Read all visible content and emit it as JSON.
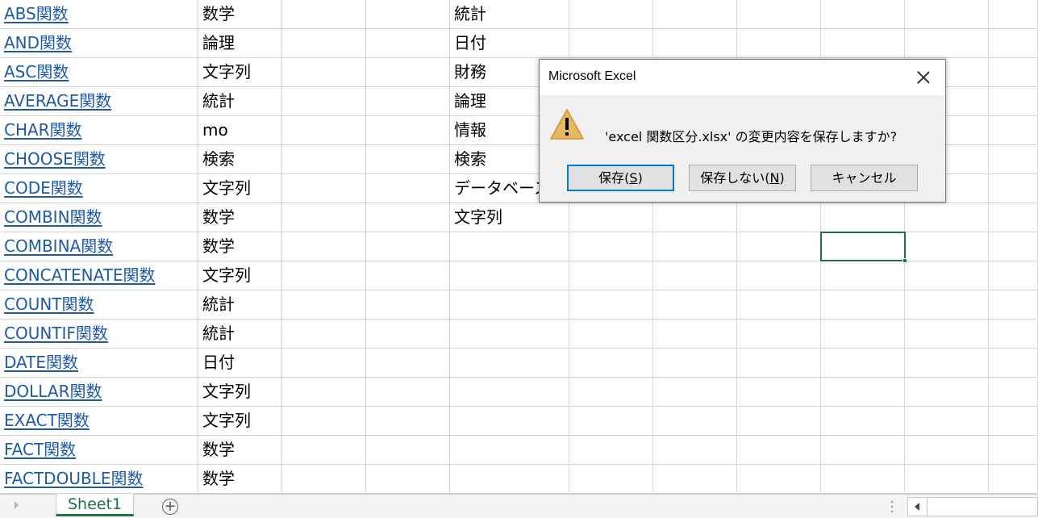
{
  "sheet": {
    "rows": [
      {
        "name": "ABS関数",
        "category": "数学",
        "list": "統計"
      },
      {
        "name": "AND関数",
        "category": "論理",
        "list": "日付"
      },
      {
        "name": "ASC関数",
        "category": "文字列",
        "list": "財務"
      },
      {
        "name": "AVERAGE関数",
        "category": "統計",
        "list": "論理"
      },
      {
        "name": "CHAR関数",
        "category": "mo",
        "list": "情報"
      },
      {
        "name": "CHOOSE関数",
        "category": "検索",
        "list": "検索"
      },
      {
        "name": "CODE関数",
        "category": "文字列",
        "list": "データベース"
      },
      {
        "name": "COMBIN関数",
        "category": "数学",
        "list": "文字列"
      },
      {
        "name": "COMBINA関数",
        "category": "数学",
        "list": ""
      },
      {
        "name": "CONCATENATE関数",
        "category": "文字列",
        "list": ""
      },
      {
        "name": "COUNT関数",
        "category": "統計",
        "list": ""
      },
      {
        "name": "COUNTIF関数",
        "category": "統計",
        "list": ""
      },
      {
        "name": "DATE関数",
        "category": "日付",
        "list": ""
      },
      {
        "name": "DOLLAR関数",
        "category": "文字列",
        "list": ""
      },
      {
        "name": "EXACT関数",
        "category": "文字列",
        "list": ""
      },
      {
        "name": "FACT関数",
        "category": "数学",
        "list": ""
      },
      {
        "name": "FACTDOUBLE関数",
        "category": "数学",
        "list": ""
      }
    ]
  },
  "tabbar": {
    "sheet_tab": "Sheet1",
    "add_sheet": "+"
  },
  "dialog": {
    "title": "Microsoft Excel",
    "message": "'excel 関数区分.xlsx' の変更内容を保存しますか?",
    "buttons": {
      "save": {
        "label": "保存(",
        "accel": "S",
        "suffix": ")"
      },
      "dont_save": {
        "label": "保存しない(",
        "accel": "N",
        "suffix": ")"
      },
      "cancel": {
        "label": "キャンセル"
      }
    }
  },
  "colors": {
    "link": "#1f5aa6",
    "excel_green": "#217346",
    "dialog_bg": "#f0f0f0",
    "default_button_border": "#0078d7",
    "warning_fill": "#e6b960"
  },
  "icons": {
    "warning": "warning-icon",
    "close": "close-icon",
    "add_sheet": "plus-circle-icon",
    "scroll_left": "chevron-left-icon"
  }
}
